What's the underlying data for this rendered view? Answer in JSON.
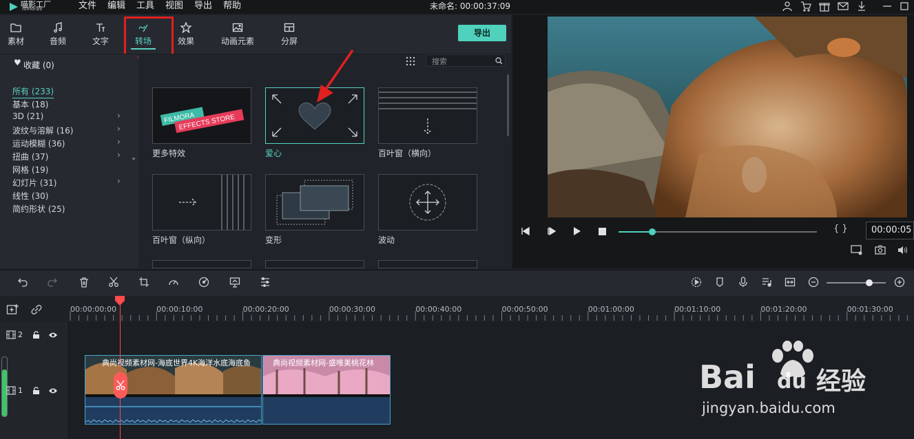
{
  "app": {
    "logo_cn": "喵影工厂",
    "logo_en": "filmora9"
  },
  "menu": [
    "文件",
    "编辑",
    "工具",
    "视图",
    "导出",
    "帮助"
  ],
  "doc_title": "未命名: 00:00:37:09",
  "tabs": [
    {
      "label": "素材",
      "icon": "folder-icon"
    },
    {
      "label": "音频",
      "icon": "music-note-icon"
    },
    {
      "label": "文字",
      "icon": "text-icon"
    },
    {
      "label": "转场",
      "icon": "transition-icon",
      "active": true
    },
    {
      "label": "效果",
      "icon": "effects-icon"
    },
    {
      "label": "动画元素",
      "icon": "image-icon"
    },
    {
      "label": "分屏",
      "icon": "split-screen-icon"
    }
  ],
  "export_label": "导出",
  "favorites": "收藏 (0)",
  "categories": [
    {
      "label": "所有 (233)",
      "active": true,
      "arrow": false
    },
    {
      "label": "基本 (18)",
      "arrow": false
    },
    {
      "label": "3D (21)",
      "arrow": true
    },
    {
      "label": "波纹与溶解 (16)",
      "arrow": true
    },
    {
      "label": "运动模糊 (36)",
      "arrow": true
    },
    {
      "label": "扭曲 (37)",
      "arrow": true
    },
    {
      "label": "网格 (19)",
      "arrow": false
    },
    {
      "label": "幻灯片 (31)",
      "arrow": true
    },
    {
      "label": "线性 (30)",
      "arrow": false
    },
    {
      "label": "简约形状 (25)",
      "arrow": false
    }
  ],
  "search_placeholder": "搜索",
  "transitions": [
    {
      "label": "更多特效",
      "banner1": "FILMORA",
      "banner2": "EFFECTS STORE"
    },
    {
      "label": "爱心",
      "selected": true
    },
    {
      "label": "百叶窗（横向）"
    },
    {
      "label": "百叶窗（纵向）"
    },
    {
      "label": "变形"
    },
    {
      "label": "波动"
    }
  ],
  "preview": {
    "time": "00:00:05",
    "progress": 0.17,
    "brackets": "{ }"
  },
  "ruler_times": [
    "00:00:00:00",
    "00:00:10:00",
    "00:00:20:00",
    "00:00:30:00",
    "00:00:40:00",
    "00:00:50:00",
    "00:01:00:00",
    "00:01:10:00",
    "00:01:20:00",
    "00:01:30:00"
  ],
  "tracks": [
    {
      "num": "2"
    },
    {
      "num": "1"
    }
  ],
  "clips": [
    {
      "label": "典尚视频素材网-海底世界4K海洋水底海底鱼"
    },
    {
      "label": "典尚视频素材网-盛唯美桃花林"
    }
  ],
  "zoom_level": 0.72,
  "watermark": {
    "brand": "Bai",
    "brand2": "du",
    "cn": "经验",
    "url": "jingyan.baidu.com"
  },
  "colors": {
    "accent": "#5ad2c4",
    "highlight": "#e02020",
    "playhead": "#ff4b4b",
    "clip": "#203c5e"
  }
}
